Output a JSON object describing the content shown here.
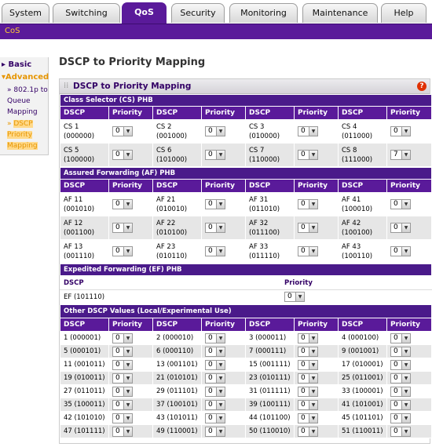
{
  "tabs": [
    "System",
    "Switching",
    "QoS",
    "Security",
    "Monitoring",
    "Maintenance",
    "Help"
  ],
  "active_tab": "QoS",
  "subnav": "CoS",
  "leftnav": {
    "basic": "Basic",
    "advanced": "Advanced",
    "items": [
      "802.1p to Queue Mapping",
      "DSCP Priority Mapping"
    ],
    "active": "DSCP Priority Mapping"
  },
  "page_title": "DSCP to Priority Mapping",
  "panel_title": "DSCP to Priority Mapping",
  "col_dscp": "DSCP",
  "col_priority": "Priority",
  "sections": {
    "cs": "Class Selector (CS) PHB",
    "af": "Assured Forwarding (AF) PHB",
    "ef": "Expedited Forwarding (EF) PHB",
    "other": "Other DSCP Values (Local/Experimental Use)"
  },
  "cs_rows": [
    [
      {
        "name": "CS 1",
        "code": "(000000)",
        "prio": "0"
      },
      {
        "name": "CS 2",
        "code": "(001000)",
        "prio": "0"
      },
      {
        "name": "CS 3",
        "code": "(010000)",
        "prio": "0"
      },
      {
        "name": "CS 4",
        "code": "(011000)",
        "prio": "0"
      }
    ],
    [
      {
        "name": "CS 5",
        "code": "(100000)",
        "prio": "0"
      },
      {
        "name": "CS 6",
        "code": "(101000)",
        "prio": "0"
      },
      {
        "name": "CS 7",
        "code": "(110000)",
        "prio": "0"
      },
      {
        "name": "CS 8",
        "code": "(111000)",
        "prio": "7"
      }
    ]
  ],
  "af_rows": [
    [
      {
        "name": "AF 11",
        "code": "(001010)",
        "prio": "0"
      },
      {
        "name": "AF 21",
        "code": "(010010)",
        "prio": "0"
      },
      {
        "name": "AF 31",
        "code": "(011010)",
        "prio": "0"
      },
      {
        "name": "AF 41",
        "code": "(100010)",
        "prio": "0"
      }
    ],
    [
      {
        "name": "AF 12",
        "code": "(001100)",
        "prio": "0"
      },
      {
        "name": "AF 22",
        "code": "(010100)",
        "prio": "0"
      },
      {
        "name": "AF 32",
        "code": "(011100)",
        "prio": "0"
      },
      {
        "name": "AF 42",
        "code": "(100100)",
        "prio": "0"
      }
    ],
    [
      {
        "name": "AF 13",
        "code": "(001110)",
        "prio": "0"
      },
      {
        "name": "AF 23",
        "code": "(010110)",
        "prio": "0"
      },
      {
        "name": "AF 33",
        "code": "(011110)",
        "prio": "0"
      },
      {
        "name": "AF 43",
        "code": "(100110)",
        "prio": "0"
      }
    ]
  ],
  "ef": {
    "label": "EF (101110)",
    "prio": "0"
  },
  "other_rows": [
    [
      {
        "name": "1 (000001)",
        "prio": "0"
      },
      {
        "name": "2 (000010)",
        "prio": "0"
      },
      {
        "name": "3 (000011)",
        "prio": "0"
      },
      {
        "name": "4 (000100)",
        "prio": "0"
      }
    ],
    [
      {
        "name": "5 (000101)",
        "prio": "0"
      },
      {
        "name": "6 (000110)",
        "prio": "0"
      },
      {
        "name": "7 (000111)",
        "prio": "0"
      },
      {
        "name": "9 (001001)",
        "prio": "0"
      }
    ],
    [
      {
        "name": "11 (001011)",
        "prio": "0"
      },
      {
        "name": "13 (001101)",
        "prio": "0"
      },
      {
        "name": "15 (001111)",
        "prio": "0"
      },
      {
        "name": "17 (010001)",
        "prio": "0"
      }
    ],
    [
      {
        "name": "19 (010011)",
        "prio": "0"
      },
      {
        "name": "21 (010101)",
        "prio": "0"
      },
      {
        "name": "23 (010111)",
        "prio": "0"
      },
      {
        "name": "25 (011001)",
        "prio": "0"
      }
    ],
    [
      {
        "name": "27 (011011)",
        "prio": "0"
      },
      {
        "name": "29 (011101)",
        "prio": "0"
      },
      {
        "name": "31 (011111)",
        "prio": "0"
      },
      {
        "name": "33 (100001)",
        "prio": "0"
      }
    ],
    [
      {
        "name": "35 (100011)",
        "prio": "0"
      },
      {
        "name": "37 (100101)",
        "prio": "0"
      },
      {
        "name": "39 (100111)",
        "prio": "0"
      },
      {
        "name": "41 (101001)",
        "prio": "0"
      }
    ],
    [
      {
        "name": "42 (101010)",
        "prio": "0"
      },
      {
        "name": "43 (101011)",
        "prio": "0"
      },
      {
        "name": "44 (101100)",
        "prio": "0"
      },
      {
        "name": "45 (101101)",
        "prio": "0"
      }
    ],
    [
      {
        "name": "47 (101111)",
        "prio": "0"
      },
      {
        "name": "49 (110001)",
        "prio": "0"
      },
      {
        "name": "50 (110010)",
        "prio": "0"
      },
      {
        "name": "51 (110011)",
        "prio": "0"
      }
    ]
  ],
  "colors": {
    "brand": "#5a1a9a",
    "accent": "#e69500"
  },
  "icons": {
    "help": "help-icon",
    "dropdown": "chevron-down-icon"
  }
}
